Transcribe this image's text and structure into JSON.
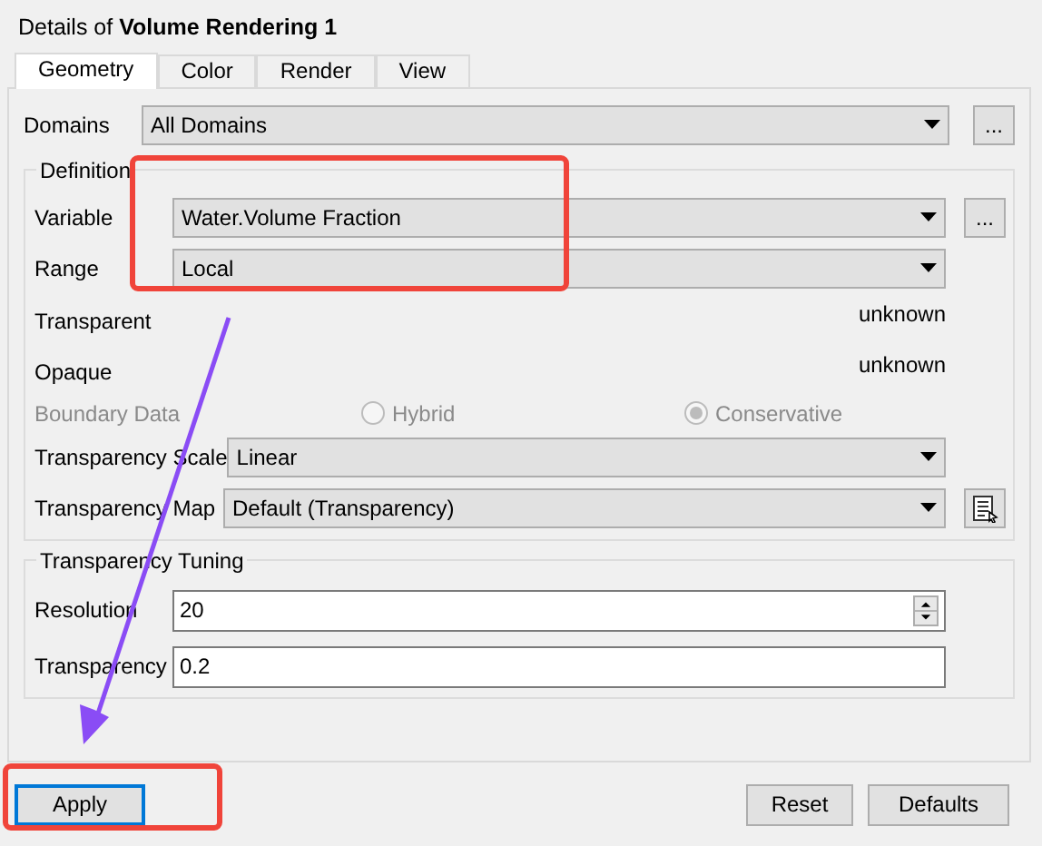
{
  "title": "Details of **Volume Rendering 1**",
  "tabs": [
    {
      "label": "Geometry",
      "selected": true
    },
    {
      "label": "Color",
      "selected": false
    },
    {
      "label": "Render",
      "selected": false
    },
    {
      "label": "View",
      "selected": false
    }
  ],
  "domains": {
    "label": "Domains",
    "value": "All Domains",
    "side_button": "..."
  },
  "definition": {
    "title": "Definition",
    "fields": [
      {
        "kind": "select",
        "label": "Variable",
        "value": "Water.Volume Fraction",
        "side_button": "..."
      },
      {
        "kind": "select",
        "label": "Range",
        "value": "Local"
      },
      {
        "kind": "readout",
        "label": "Transparent",
        "value": "unknown"
      },
      {
        "kind": "readout",
        "label": "Opaque",
        "value": "unknown"
      },
      {
        "kind": "radio",
        "label": "Boundary Data",
        "disabled": true,
        "options": [
          {
            "label": "Hybrid",
            "selected": false
          },
          {
            "label": "Conservative",
            "selected": true
          }
        ]
      },
      {
        "kind": "select",
        "label": "Transparency Scale",
        "value": "Linear"
      },
      {
        "kind": "select",
        "label": "Transparency Map",
        "value": "Default (Transparency)",
        "side_icon": true
      }
    ]
  },
  "tuning": {
    "title": "Transparency Tuning",
    "fields": [
      {
        "kind": "spin",
        "label": "Resolution",
        "value": "20"
      },
      {
        "kind": "text",
        "label": "Transparency",
        "value": "0.2"
      }
    ]
  },
  "buttons": [
    {
      "label": "Apply",
      "focused": true
    },
    {
      "label": "Reset",
      "focused": false
    },
    {
      "label": "Defaults",
      "focused": false
    }
  ],
  "annotations": [
    {
      "kind": "highlight-box"
    },
    {
      "kind": "highlight-box"
    },
    {
      "kind": "arrow"
    }
  ]
}
